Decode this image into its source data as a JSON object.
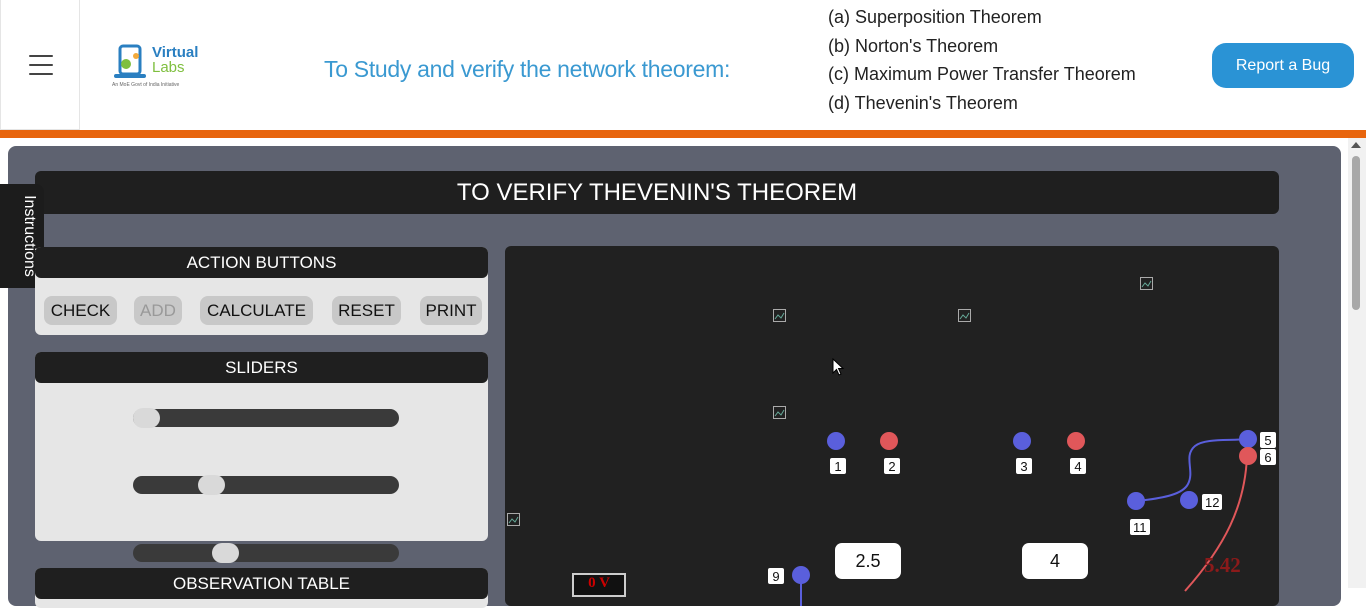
{
  "header": {
    "logo": {
      "line1": "Virtual",
      "line2": "Labs",
      "tagline": "An MoE Govt of India Initiative"
    },
    "title": "To Study and verify the network theorem:",
    "theorems": [
      "(a) Superposition Theorem",
      "(b) Norton's Theorem",
      "(c) Maximum Power Transfer Theorem",
      "(d) Thevenin's Theorem"
    ],
    "report_bug_label": "Report a Bug"
  },
  "instructions_tab": "Instructions",
  "page_title": "TO VERIFY THEVENIN'S THEOREM",
  "action_panel": {
    "heading": "ACTION BUTTONS",
    "buttons": [
      "CHECK",
      "ADD",
      "CALCULATE",
      "RESET",
      "PRINT"
    ]
  },
  "sliders_panel": {
    "heading": "SLIDERS",
    "slider_levels": [
      0.0,
      0.27,
      0.33
    ]
  },
  "observation_panel": {
    "heading": "OBSERVATION TABLE"
  },
  "circuit": {
    "readout": "5.42",
    "voltmeter": "0 V",
    "terminal_labels": [
      "1",
      "2",
      "3",
      "4",
      "5",
      "6",
      "9",
      "11",
      "12"
    ],
    "value_boxes": [
      "2.5",
      "4"
    ]
  },
  "colors": {
    "accent_blue": "#2a93d5",
    "orange_bar": "#e8650d",
    "terminal_blue": "#5a5fdc",
    "terminal_red": "#e0575a"
  }
}
